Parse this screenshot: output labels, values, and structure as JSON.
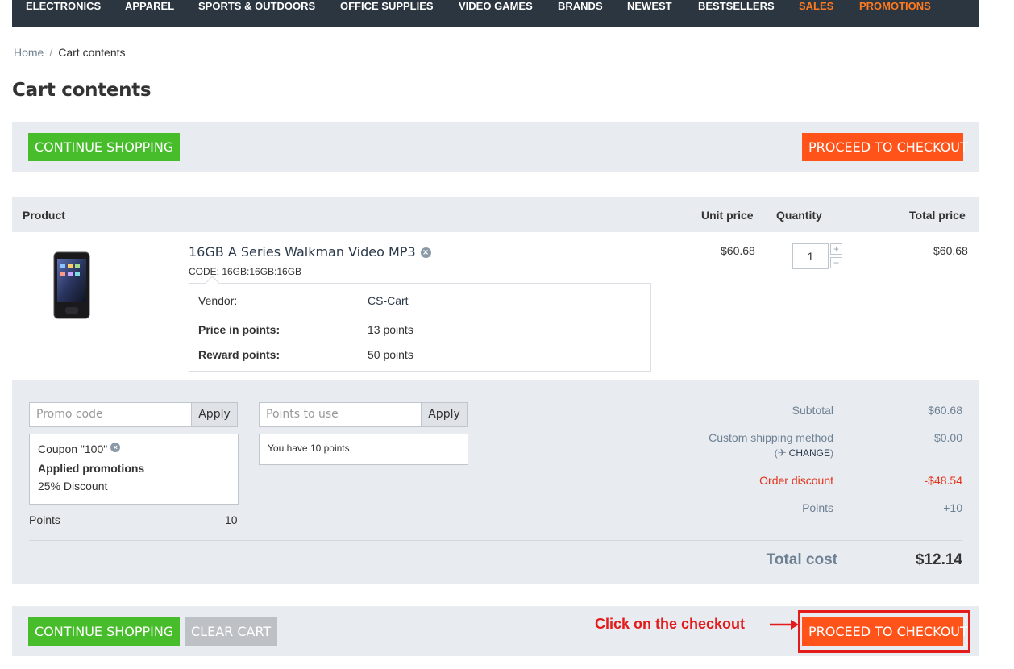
{
  "nav": {
    "items": [
      {
        "label": "ELECTRONICS",
        "highlight": false
      },
      {
        "label": "APPAREL",
        "highlight": false
      },
      {
        "label": "SPORTS & OUTDOORS",
        "highlight": false
      },
      {
        "label": "OFFICE SUPPLIES",
        "highlight": false
      },
      {
        "label": "VIDEO GAMES",
        "highlight": false
      },
      {
        "label": "BRANDS",
        "highlight": false
      },
      {
        "label": "NEWEST",
        "highlight": false
      },
      {
        "label": "BESTSELLERS",
        "highlight": false
      },
      {
        "label": "SALES",
        "highlight": true
      },
      {
        "label": "PROMOTIONS",
        "highlight": true
      }
    ]
  },
  "breadcrumb": {
    "home": "Home",
    "separator": "/",
    "current": "Cart contents"
  },
  "page": {
    "title": "Cart contents"
  },
  "top_buttons": {
    "continue": "CONTINUE SHOPPING",
    "checkout": "PROCEED TO CHECKOUT"
  },
  "table": {
    "headers": {
      "product": "Product",
      "unit_price": "Unit price",
      "quantity": "Quantity",
      "total_price": "Total price"
    }
  },
  "item": {
    "name": "16GB A Series Walkman Video MP3",
    "code": "CODE: 16GB:16GB:16GB",
    "vendor_label": "Vendor:",
    "vendor_value": "CS-Cart",
    "price_points_label": "Price in points:",
    "price_points_value": "13 points",
    "reward_points_label": "Reward points:",
    "reward_points_value": "50 points",
    "unit_price": "$60.68",
    "quantity": "1",
    "total_price": "$60.68",
    "remove_glyph": "×",
    "increase_glyph": "+",
    "decrease_glyph": "−"
  },
  "promo": {
    "placeholder": "Promo code",
    "apply": "Apply",
    "coupon": "Coupon \"100\"",
    "remove_glyph": "×",
    "applied_title": "Applied promotions",
    "discount": "25% Discount"
  },
  "points_use": {
    "placeholder": "Points to use",
    "apply": "Apply",
    "note": "You have 10 points."
  },
  "points_row": {
    "label": "Points",
    "value": "10"
  },
  "summary": {
    "subtotal_label": "Subtotal",
    "subtotal_value": "$60.68",
    "shipping_label": "Custom shipping method",
    "shipping_value": "$0.00",
    "change_open": "(",
    "change_glyph": "✈",
    "change_label": "CHANGE",
    "change_close": ")",
    "discount_label": "Order discount",
    "discount_value": "-$48.54",
    "points_label": "Points",
    "points_value": "+10",
    "total_label": "Total cost",
    "total_value": "$12.14"
  },
  "bottom_buttons": {
    "continue": "CONTINUE SHOPPING",
    "clear": "CLEAR CART",
    "checkout": "PROCEED TO CHECKOUT"
  },
  "annotation": {
    "text": "Click on the checkout",
    "color": "#e31b1b"
  },
  "colors": {
    "nav_bg": "#2b3640",
    "green": "#48bd2b",
    "orange": "#ff5319",
    "panel_bg": "#e8ebef",
    "discount_red": "#e3341b"
  }
}
